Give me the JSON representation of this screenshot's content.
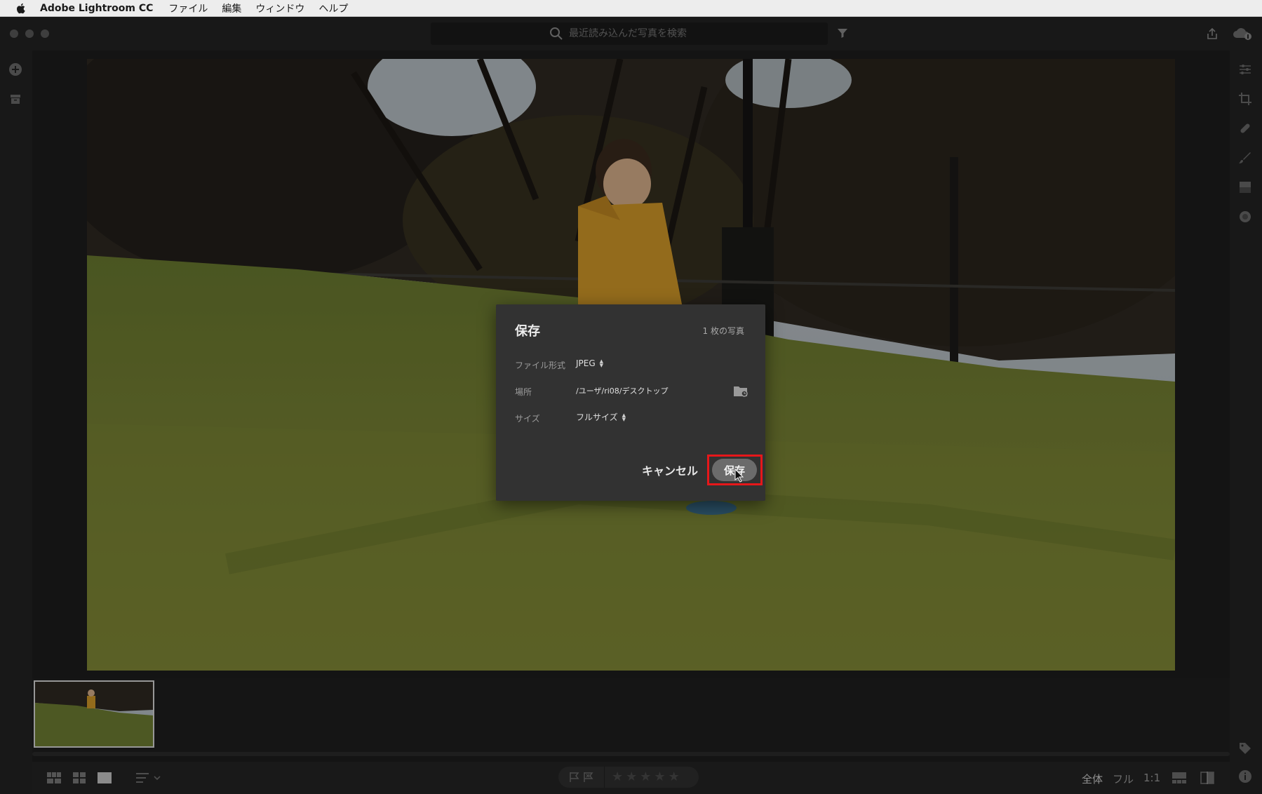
{
  "menubar": {
    "app_name": "Adobe Lightroom CC",
    "items": [
      "ファイル",
      "編集",
      "ウィンドウ",
      "ヘルプ"
    ]
  },
  "titlebar": {
    "search_placeholder": "最近読み込んだ写真を検索"
  },
  "photo": {
    "subject": "child in yellow jacket on grassy slope",
    "colors": {
      "sky": "#b9c2c8",
      "trees": "#2b2620",
      "grass": "#6f7f33",
      "jacket": "#d29a2a"
    }
  },
  "bottombar": {
    "stars": [
      "★",
      "★",
      "★",
      "★",
      "★"
    ],
    "zoom_fit": "全体",
    "zoom_fill": "フル",
    "zoom_1to1": "1:1"
  },
  "dialog": {
    "title": "保存",
    "photo_count": "1 枚の写真",
    "file_format_label": "ファイル形式",
    "file_format_value": "JPEG",
    "location_label": "場所",
    "location_value": "/ユーザ/ri08/デスクトップ",
    "size_label": "サイズ",
    "size_value": "フルサイズ",
    "cancel_label": "キャンセル",
    "save_label": "保存",
    "highlight_color": "#e6171a"
  }
}
